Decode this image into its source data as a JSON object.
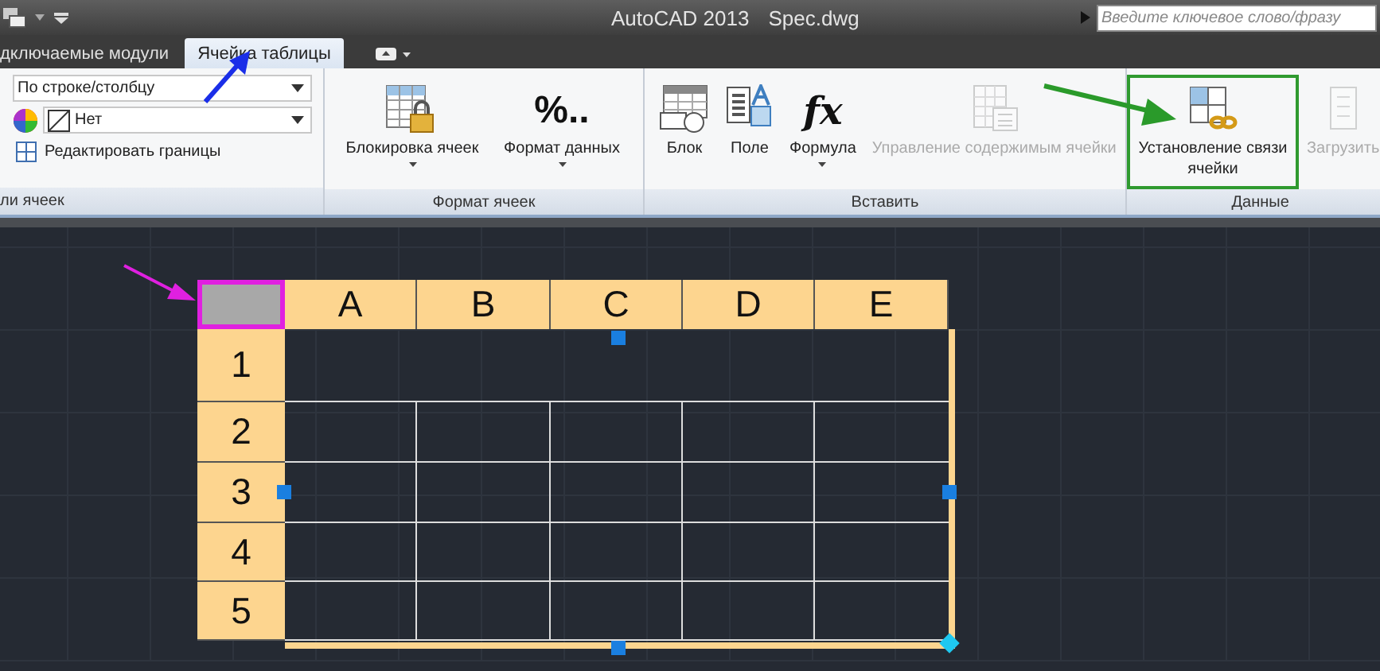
{
  "title_bar": {
    "title": "AutoCAD 2013",
    "file": "Spec.dwg",
    "search": {
      "placeholder": "Введите ключевое слово/фразу"
    }
  },
  "tabs": [
    {
      "label": "дключаемые модули",
      "selected": false
    },
    {
      "label": "Ячейка таблицы",
      "selected": true
    }
  ],
  "panels": [
    {
      "label": "ли ячеек",
      "controls": [
        {
          "kind": "dropdown",
          "value": "По строке/столбцу"
        },
        {
          "kind": "color-dropdown",
          "value": "Нет"
        },
        {
          "kind": "small-button",
          "label": "Редактировать границы"
        }
      ]
    },
    {
      "label": "Формат ячеек",
      "controls": [
        {
          "kind": "large-button",
          "label": "Блокировка ячеек",
          "dropdown": true,
          "disabled": false,
          "highlighted": false
        },
        {
          "kind": "large-button",
          "icon_text": "%..",
          "label": "Формат данных",
          "dropdown": true,
          "disabled": false,
          "highlighted": false
        }
      ]
    },
    {
      "label": "Вставить",
      "controls": [
        {
          "kind": "large-button",
          "label": "Блок",
          "dropdown": false,
          "disabled": false,
          "highlighted": false
        },
        {
          "kind": "large-button",
          "label": "Поле",
          "dropdown": false,
          "disabled": false,
          "highlighted": false
        },
        {
          "kind": "large-button",
          "icon_text": "fx",
          "label": "Формула",
          "dropdown": true,
          "disabled": false,
          "highlighted": false
        },
        {
          "kind": "large-button",
          "label": "Управление содержимым ячейки",
          "dropdown": false,
          "disabled": true,
          "highlighted": false
        }
      ]
    },
    {
      "label": "Данные",
      "controls": [
        {
          "kind": "large-button",
          "label": "Установление связи ячейки",
          "dropdown": false,
          "disabled": false,
          "highlighted": true
        },
        {
          "kind": "large-button",
          "label": "Загрузить",
          "dropdown": false,
          "disabled": true,
          "highlighted": false
        }
      ]
    }
  ],
  "table": {
    "corner": {
      "selected": true
    },
    "columns": [
      "A",
      "B",
      "C",
      "D",
      "E"
    ],
    "rows": [
      {
        "label": "1",
        "merged": true
      },
      {
        "label": "2",
        "merged": false
      },
      {
        "label": "3",
        "merged": false
      },
      {
        "label": "4",
        "merged": false
      },
      {
        "label": "5",
        "merged": false
      }
    ]
  }
}
